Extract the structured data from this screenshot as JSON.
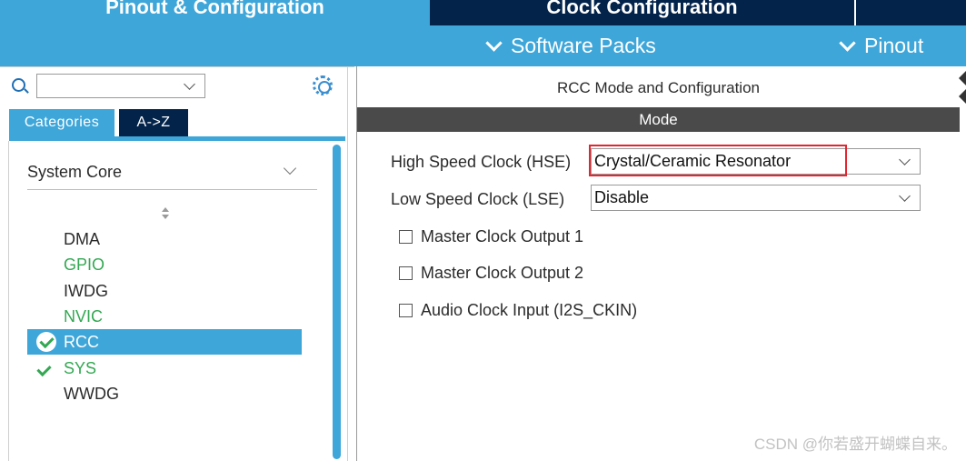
{
  "top_tabs": {
    "pinout": "Pinout & Configuration",
    "clock": "Clock Configuration"
  },
  "sub_bar": {
    "software_packs": "Software Packs",
    "pinout": "Pinout"
  },
  "sidebar": {
    "search": {
      "value": ""
    },
    "tabs": [
      "Categories",
      "A->Z"
    ],
    "category": "System Core",
    "items": [
      {
        "label": "DMA",
        "status": "none"
      },
      {
        "label": "GPIO",
        "status": "configured"
      },
      {
        "label": "IWDG",
        "status": "none"
      },
      {
        "label": "NVIC",
        "status": "configured"
      },
      {
        "label": "RCC",
        "status": "selected"
      },
      {
        "label": "SYS",
        "status": "ok"
      },
      {
        "label": "WWDG",
        "status": "none"
      }
    ]
  },
  "panel": {
    "title": "RCC Mode and Configuration",
    "section": "Mode",
    "fields": [
      {
        "label": "High Speed Clock (HSE)",
        "value": "Crystal/Ceramic Resonator"
      },
      {
        "label": "Low Speed Clock (LSE)",
        "value": "Disable"
      }
    ],
    "checkboxes": [
      {
        "label": "Master Clock Output 1",
        "checked": false
      },
      {
        "label": "Master Clock Output 2",
        "checked": false
      },
      {
        "label": "Audio Clock Input (I2S_CKIN)",
        "checked": false
      }
    ]
  },
  "watermark": "CSDN @你若盛开蝴蝶自来。",
  "colors": {
    "accent": "#3ea6d9",
    "dark": "#03234b",
    "ok": "#33a852",
    "highlight": "#e32630"
  }
}
